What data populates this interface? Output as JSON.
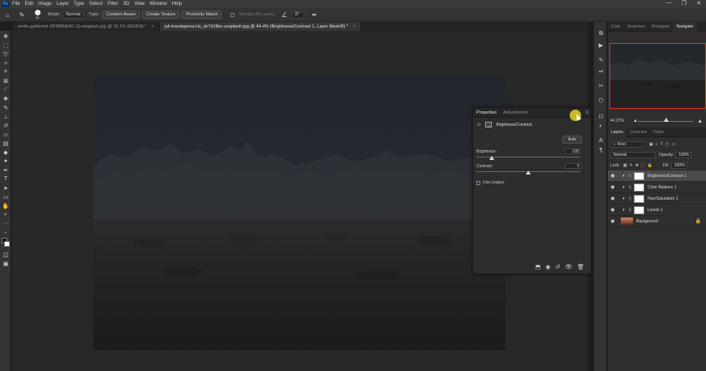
{
  "app": {
    "logo": "Ps",
    "menu": [
      "File",
      "Edit",
      "Image",
      "Layer",
      "Type",
      "Select",
      "Filter",
      "3D",
      "View",
      "Window",
      "Help"
    ],
    "window_controls": [
      "—",
      "❐",
      "✕"
    ]
  },
  "options_bar": {
    "brush_size": "40",
    "mode_label": "Mode:",
    "mode_value": "Normal",
    "type_label": "Type:",
    "type_buttons": [
      "Content-Aware",
      "Create Texture",
      "Proximity Match"
    ],
    "sample_all_layers": "Sample All Layers",
    "angle_value": "0°"
  },
  "doc_tabs": [
    {
      "label": "emile-guillemot-1fFWBbEAC-Q-unsplash.jpg @ 15.1% (RGB/8) *",
      "active": false
    },
    {
      "label": "juli-kosolapova-Us_dv7d1fibc-unsplash.jpg @ 44.4% (Brightness/Contrast 1, Layer Mask/8) *",
      "active": true
    }
  ],
  "properties": {
    "tabs": [
      "Properties",
      "Adjustments"
    ],
    "title": "Brightness/Contrast",
    "auto_label": "Auto",
    "brightness_label": "Brightness:",
    "brightness_value": "-105",
    "brightness_level": -105,
    "contrast_label": "Contrast:",
    "contrast_value": "0",
    "contrast_level": 0,
    "use_legacy": "Use Legacy"
  },
  "right_panels": {
    "top_tabs": [
      "Color",
      "Swatches",
      "Histogram",
      "Navigator"
    ],
    "zoom": "44.37%",
    "layers_tabs": [
      "Layers",
      "Channels",
      "Paths"
    ],
    "kind_label": "Kind",
    "blend_mode": "Normal",
    "opacity_label": "Opacity:",
    "opacity_value": "100%",
    "lock_label": "Lock:",
    "fill_label": "Fill:",
    "fill_value": "100%",
    "layers": [
      {
        "name": "Brightness/Contrast 1",
        "type": "adjustment",
        "selected": true
      },
      {
        "name": "Color Balance 1",
        "type": "adjustment",
        "selected": false
      },
      {
        "name": "Hue/Saturation 1",
        "type": "adjustment",
        "selected": false
      },
      {
        "name": "Levels 1",
        "type": "adjustment",
        "selected": false
      },
      {
        "name": "Background",
        "type": "image",
        "selected": false
      }
    ]
  },
  "colors": {
    "accent_red": "#e0302a",
    "cursor_highlight": "#e6d228",
    "panel_bg": "#2f2f2f"
  }
}
